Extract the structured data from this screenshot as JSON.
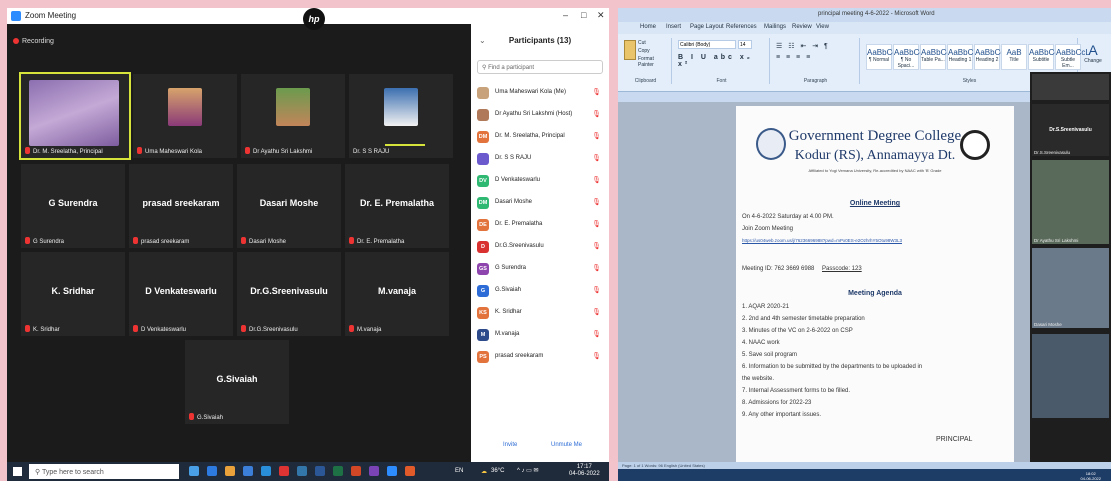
{
  "zoom": {
    "window_title": "Zoom Meeting",
    "recording_label": "Recording",
    "window_controls": [
      "–",
      "□",
      "✕"
    ],
    "tiles": [
      {
        "label": "Dr. M. Sreelatha, Principal",
        "display_name": "",
        "has_photo": true,
        "active": true
      },
      {
        "label": "Uma Maheswari Kola",
        "display_name": "",
        "has_photo": true
      },
      {
        "label": "Dr Ayathu Sri Lakshmi",
        "display_name": "",
        "has_photo": true
      },
      {
        "label": "Dr. S S RAJU",
        "display_name": "",
        "has_photo": true
      },
      {
        "label": "G Surendra",
        "display_name": "G Surendra"
      },
      {
        "label": "prasad sreekaram",
        "display_name": "prasad sreekaram"
      },
      {
        "label": "Dasari Moshe",
        "display_name": "Dasari Moshe"
      },
      {
        "label": "Dr. E. Premalatha",
        "display_name": "Dr. E. Premalatha"
      },
      {
        "label": "K. Sridhar",
        "display_name": "K. Sridhar"
      },
      {
        "label": "D Venkateswarlu",
        "display_name": "D Venkateswarlu"
      },
      {
        "label": "Dr.G.Sreenivasulu",
        "display_name": "Dr.G.Sreenivasulu"
      },
      {
        "label": "M.vanaja",
        "display_name": "M.vanaja"
      },
      {
        "label": "G.Sivaiah",
        "display_name": "G.Sivaiah"
      }
    ],
    "participants_panel": {
      "title": "Participants (13)",
      "search_placeholder": "Find a participant",
      "participants": [
        {
          "avatar": "",
          "name": "Uma Maheswari Kola (Me)",
          "color": "#c8a27a"
        },
        {
          "avatar": "",
          "name": "Dr Ayathu Sri Lakshmi (Host)",
          "color": "#b07a5a"
        },
        {
          "avatar": "DM",
          "name": "Dr. M. Sreelatha, Principal",
          "color": "#e2733c"
        },
        {
          "avatar": "",
          "name": "Dr. S S RAJU",
          "color": "#6a5acd"
        },
        {
          "avatar": "DV",
          "name": "D Venkateswarlu",
          "color": "#2eb872"
        },
        {
          "avatar": "DM",
          "name": "Dasari Moshe",
          "color": "#2eb872"
        },
        {
          "avatar": "DE",
          "name": "Dr. E. Premalatha",
          "color": "#e2733c"
        },
        {
          "avatar": "D",
          "name": "Dr.G.Sreenivasulu",
          "color": "#d93030"
        },
        {
          "avatar": "GS",
          "name": "G Surendra",
          "color": "#8e44ad"
        },
        {
          "avatar": "G",
          "name": "G.Sivaiah",
          "color": "#2d6cd6"
        },
        {
          "avatar": "KS",
          "name": "K. Sridhar",
          "color": "#e2733c"
        },
        {
          "avatar": "M",
          "name": "M.vanaja",
          "color": "#2d4a8a"
        },
        {
          "avatar": "PS",
          "name": "prasad sreekaram",
          "color": "#e2733c"
        }
      ],
      "invite_label": "Invite",
      "unmute_label": "Unmute Me"
    },
    "taskbar": {
      "search_placeholder": "Type here to search",
      "weather": "36°C",
      "time": "17:17",
      "date": "04-06-2022",
      "lang": "EN"
    }
  },
  "word": {
    "window_title": "principal meeting 4-6-2022 - Microsoft Word",
    "tabs": [
      "Home",
      "Insert",
      "Page Layout",
      "References",
      "Mailings",
      "Review",
      "View"
    ],
    "ribbon": {
      "clipboard": "Clipboard",
      "font": "Font",
      "paragraph": "Paragraph",
      "styles": "Styles",
      "font_name": "Calibri (Body)",
      "font_size": "14",
      "paste_items": [
        "Cut",
        "Copy",
        "Format Painter"
      ],
      "style_samples": [
        {
          "sample": "AaBbCcDc",
          "name": "¶ Normal"
        },
        {
          "sample": "AaBbCcDc",
          "name": "¶ No Spaci..."
        },
        {
          "sample": "AaBbCcL",
          "name": "Table Pa..."
        },
        {
          "sample": "AaBbC",
          "name": "Heading 1"
        },
        {
          "sample": "AaBbCc",
          "name": "Heading 2"
        },
        {
          "sample": "AaB",
          "name": "Title"
        },
        {
          "sample": "AaBbCc",
          "name": "Subtitle"
        },
        {
          "sample": "AaBbCcL",
          "name": "Subtle Em..."
        }
      ],
      "change_styles": "Change"
    },
    "document": {
      "college": "Government Degree College",
      "place": "Kodur (RS), Annamayya Dt.",
      "affiliation": "Affiliated to Yogi Vemana University, Re-accredited by NAAC with 'B' Grade",
      "online_heading": "Online Meeting",
      "meeting_lines": [
        "On 4-6-2022 Saturday at 4.00 PM.",
        "Join Zoom Meeting",
        "https://us04web.zoom.us/j/76236696988?pwd=mPx0ES-e2OzhrhY5Otu98W3L3"
      ],
      "meeting_id": "Meeting ID: 762 3669 6988",
      "passcode": "Passcode: 123",
      "agenda_heading": "Meeting Agenda",
      "agenda": [
        "1. AQAR 2020-21",
        "2. 2nd and 4th semester timetable preparation",
        "3. Minutes of the VC on 2-6-2022 on CSP",
        "4. NAAC work",
        "5. Save soil program",
        "6. Information to be submitted by the departments to be uploaded in",
        "    the website.",
        "7. Internal Assessment forms to be filled.",
        "8. Admissions for 2022-23",
        "9. Any other important issues."
      ],
      "signature": "PRINCIPAL"
    },
    "status": "Page: 1 of 1   Words: 96   English (United States)",
    "gallery": [
      {
        "label": "Dr.S.Sreenivasulu",
        "center": ""
      },
      {
        "label": "Dr.S.Sreenivasulu",
        "center": "Dr.S.Sreenivasulu"
      },
      {
        "label": "Dr Ayathu Sri Lakshmi",
        "center": ""
      },
      {
        "label": "Dasari Moshe",
        "center": ""
      },
      {
        "label": "",
        "center": ""
      }
    ],
    "taskbar_time": "18:02",
    "taskbar_date": "04-06-2022"
  }
}
